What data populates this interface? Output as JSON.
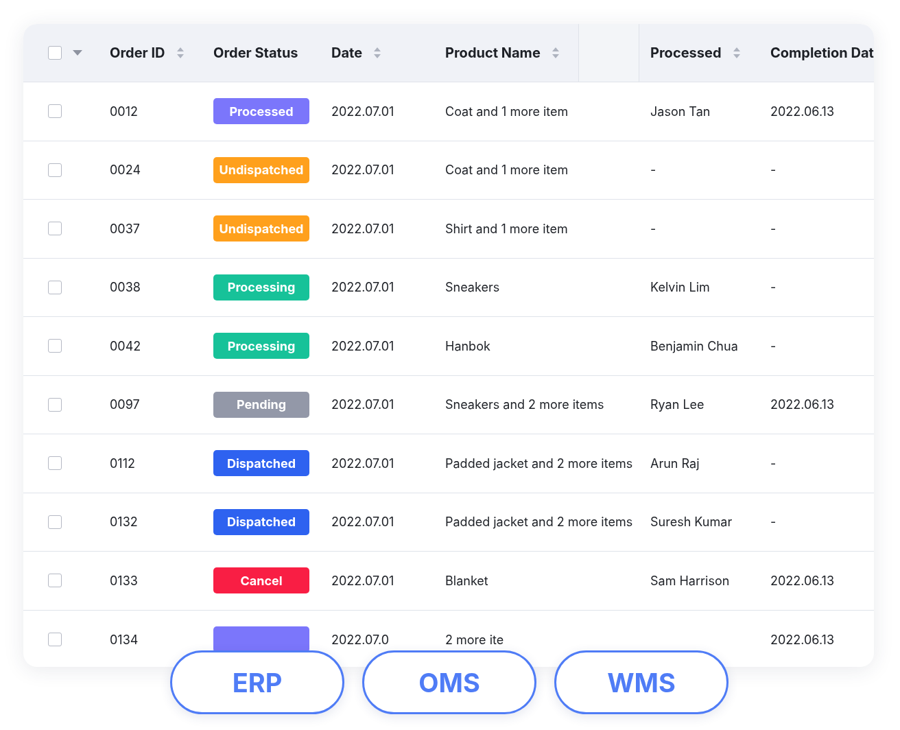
{
  "table": {
    "header_checkbox": {
      "checked": false
    },
    "columns": [
      {
        "label": "Order ID",
        "sortable": true
      },
      {
        "label": "Order Status",
        "sortable": false
      },
      {
        "label": "Date",
        "sortable": true
      },
      {
        "label": "Product Name",
        "sortable": true
      },
      {
        "label": "Processed",
        "sortable": true
      },
      {
        "label": "Completion Dat",
        "sortable": false
      }
    ],
    "rows": [
      {
        "checked": false,
        "order_id": "0012",
        "status": {
          "label": "Processed",
          "color": "#7b76fb"
        },
        "date": "2022.07.01",
        "product": "Coat and 1 more item",
        "processed": "Jason Tan",
        "completion": "2022.06.13"
      },
      {
        "checked": false,
        "order_id": "0024",
        "status": {
          "label": "Undispatched",
          "color": "#ffa01c"
        },
        "date": "2022.07.01",
        "product": "Coat and 1 more item",
        "processed": "-",
        "completion": "-"
      },
      {
        "checked": false,
        "order_id": "0037",
        "status": {
          "label": "Undispatched",
          "color": "#ffa01c"
        },
        "date": "2022.07.01",
        "product": "Shirt and 1 more item",
        "processed": "-",
        "completion": "-"
      },
      {
        "checked": false,
        "order_id": "0038",
        "status": {
          "label": "Processing",
          "color": "#17c299"
        },
        "date": "2022.07.01",
        "product": "Sneakers",
        "processed": "Kelvin Lim",
        "completion": "-"
      },
      {
        "checked": false,
        "order_id": "0042",
        "status": {
          "label": "Processing",
          "color": "#17c299"
        },
        "date": "2022.07.01",
        "product": "Hanbok",
        "processed": "Benjamin Chua",
        "completion": "-"
      },
      {
        "checked": false,
        "order_id": "0097",
        "status": {
          "label": "Pending",
          "color": "#9398a8"
        },
        "date": "2022.07.01",
        "product": "Sneakers and 2 more items",
        "processed": "Ryan Lee",
        "completion": "2022.06.13"
      },
      {
        "checked": false,
        "order_id": "0112",
        "status": {
          "label": "Dispatched",
          "color": "#2e62f0"
        },
        "date": "2022.07.01",
        "product": "Padded jacket and 2 more items",
        "processed": "Arun Raj",
        "completion": "-"
      },
      {
        "checked": false,
        "order_id": "0132",
        "status": {
          "label": "Dispatched",
          "color": "#2e62f0"
        },
        "date": "2022.07.01",
        "product": "Padded jacket and 2 more items",
        "processed": "Suresh Kumar",
        "completion": "-"
      },
      {
        "checked": false,
        "order_id": "0133",
        "status": {
          "label": "Cancel",
          "color": "#f91e44"
        },
        "date": "2022.07.01",
        "product": "Blanket",
        "processed": "Sam Harrison",
        "completion": "2022.06.13"
      },
      {
        "checked": false,
        "order_id": "0134",
        "status": {
          "color": "#7b76fb"
        },
        "date": "2022.07.0",
        "product": "2 more ite",
        "completion": "2022.06.13"
      }
    ]
  },
  "system_buttons": [
    "ERP",
    "OMS",
    "WMS"
  ]
}
